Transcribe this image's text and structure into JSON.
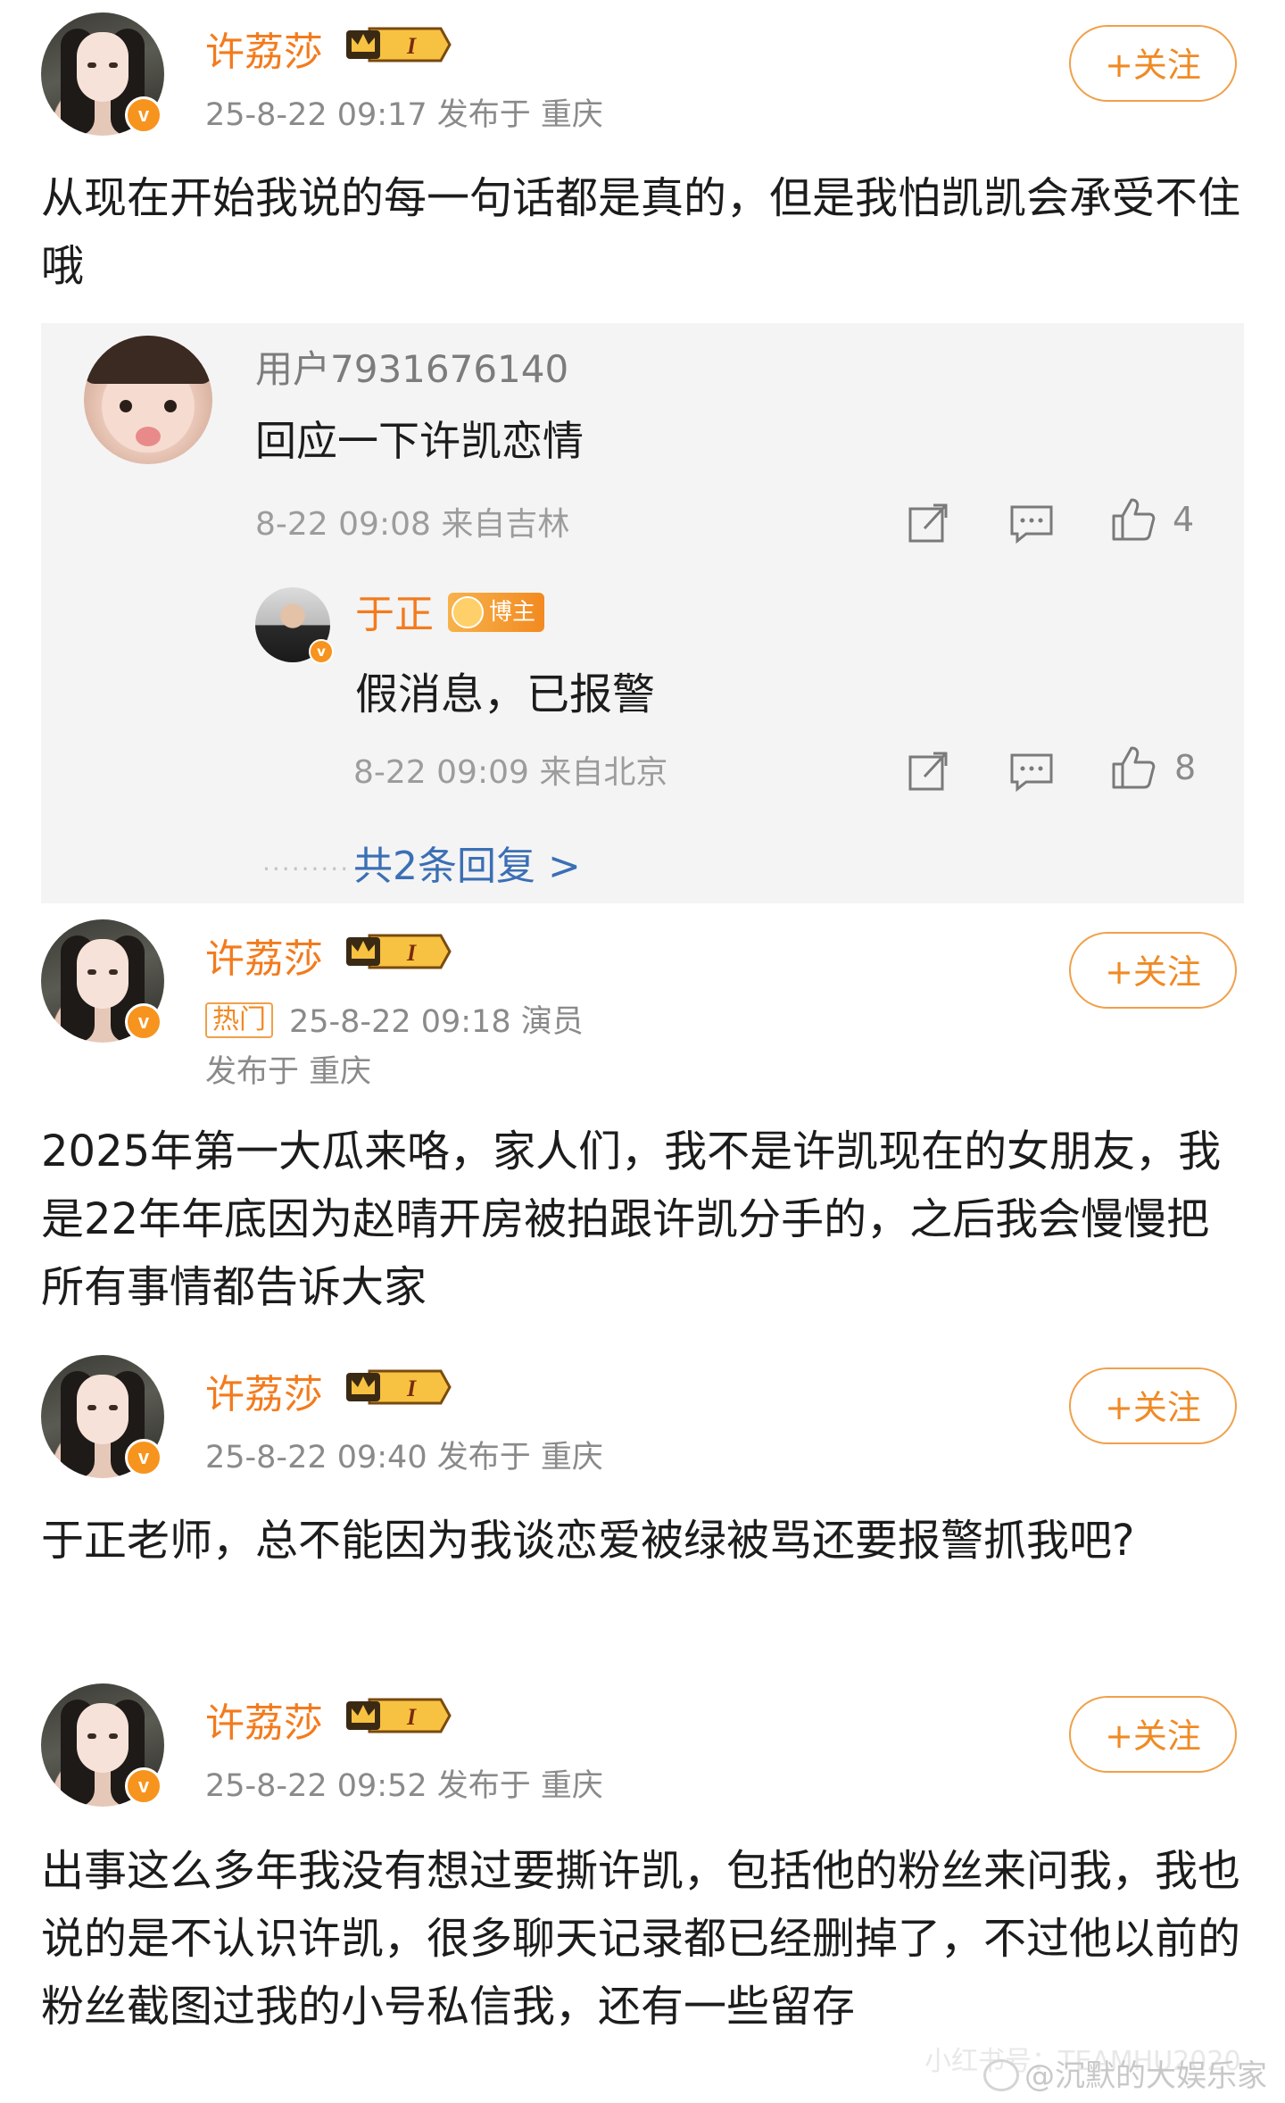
{
  "colors": {
    "username": "#f37b1d",
    "follow_border": "#f0a04a",
    "link_blue": "#3b6fb5",
    "meta_gray": "#8a8a8a",
    "comment_bg": "#f4f4f4"
  },
  "posts": [
    {
      "user": "许荔莎",
      "level_badge": "I",
      "meta_line1": "25-8-22 09:17  发布于 重庆",
      "follow_label": "+关注",
      "text": "从现在开始我说的每一句话都是真的，但是我怕凯凯会承受不住哦",
      "comment": {
        "user": "用户7931676140",
        "text": "回应一下许凯恋情",
        "meta": "8-22 09:08 来自吉林",
        "likes": "4",
        "reply": {
          "user": "于正",
          "badge": "博主",
          "text": "假消息，已报警",
          "meta": "8-22 09:09 来自北京",
          "likes": "8"
        },
        "more_replies": "共2条回复 >"
      }
    },
    {
      "user": "许荔莎",
      "level_badge": "I",
      "hot_tag": "热门",
      "meta_line1": "25-8-22 09:18  演员",
      "meta_line2": "发布于 重庆",
      "follow_label": "+关注",
      "text": "2025年第一大瓜来咯，家人们，我不是许凯现在的女朋友，我是22年年底因为赵晴开房被拍跟许凯分手的，之后我会慢慢把所有事情都告诉大家"
    },
    {
      "user": "许荔莎",
      "level_badge": "I",
      "meta_line1": "25-8-22 09:40  发布于 重庆",
      "follow_label": "+关注",
      "text": "于正老师，总不能因为我谈恋爱被绿被骂还要报警抓我吧?"
    },
    {
      "user": "许荔莎",
      "level_badge": "I",
      "meta_line1": "25-8-22 09:52  发布于 重庆",
      "follow_label": "+关注",
      "text": "出事这么多年我没有想过要撕许凯，包括他的粉丝来问我，我也说的是不认识许凯，很多聊天记录都已经删掉了，不过他以前的粉丝截图过我的小号私信我，还有一些留存"
    }
  ],
  "watermark": "@沉默的大娱乐家",
  "watermark_faint": "小红书号：TEAMHU2020"
}
